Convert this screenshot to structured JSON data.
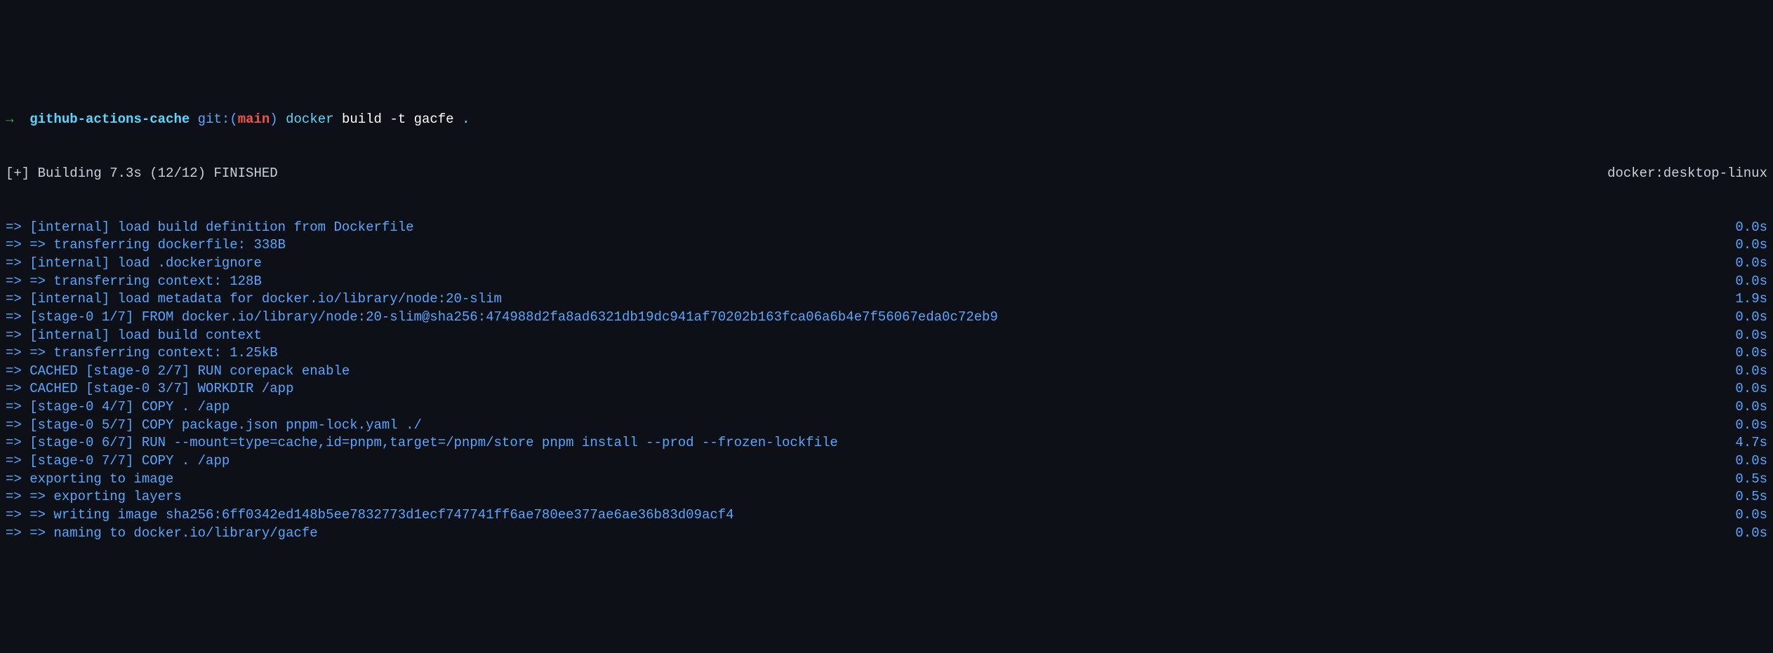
{
  "prompt": {
    "arrow": "→",
    "dir": "github-actions-cache",
    "git_label": "git:(",
    "branch": "main",
    "git_close": ")",
    "command_parts": {
      "docker": "docker",
      "build": "build",
      "flag": "-t",
      "tag": "gacfe",
      "dot": "."
    }
  },
  "build_header": {
    "left": "[+] Building 7.3s (12/12) FINISHED",
    "right": "docker:desktop-linux"
  },
  "steps": [
    {
      "left": "=> [internal] load build definition from Dockerfile",
      "right": "0.0s"
    },
    {
      "left": "=> => transferring dockerfile: 338B",
      "right": "0.0s"
    },
    {
      "left": "=> [internal] load .dockerignore",
      "right": "0.0s"
    },
    {
      "left": "=> => transferring context: 128B",
      "right": "0.0s"
    },
    {
      "left": "=> [internal] load metadata for docker.io/library/node:20-slim",
      "right": "1.9s"
    },
    {
      "left": "=> [stage-0 1/7] FROM docker.io/library/node:20-slim@sha256:474988d2fa8ad6321db19dc941af70202b163fca06a6b4e7f56067eda0c72eb9",
      "right": "0.0s"
    },
    {
      "left": "=> [internal] load build context",
      "right": "0.0s"
    },
    {
      "left": "=> => transferring context: 1.25kB",
      "right": "0.0s"
    },
    {
      "left": "=> CACHED [stage-0 2/7] RUN corepack enable",
      "right": "0.0s"
    },
    {
      "left": "=> CACHED [stage-0 3/7] WORKDIR /app",
      "right": "0.0s"
    },
    {
      "left": "=> [stage-0 4/7] COPY . /app",
      "right": "0.0s"
    },
    {
      "left": "=> [stage-0 5/7] COPY package.json pnpm-lock.yaml ./",
      "right": "0.0s"
    },
    {
      "left": "=> [stage-0 6/7] RUN --mount=type=cache,id=pnpm,target=/pnpm/store pnpm install --prod --frozen-lockfile",
      "right": "4.7s"
    },
    {
      "left": "=> [stage-0 7/7] COPY . /app",
      "right": "0.0s"
    },
    {
      "left": "=> exporting to image",
      "right": "0.5s"
    },
    {
      "left": "=> => exporting layers",
      "right": "0.5s"
    },
    {
      "left": "=> => writing image sha256:6ff0342ed148b5ee7832773d1ecf747741ff6ae780ee377ae6ae36b83d09acf4",
      "right": "0.0s"
    },
    {
      "left": "=> => naming to docker.io/library/gacfe",
      "right": "0.0s"
    }
  ]
}
